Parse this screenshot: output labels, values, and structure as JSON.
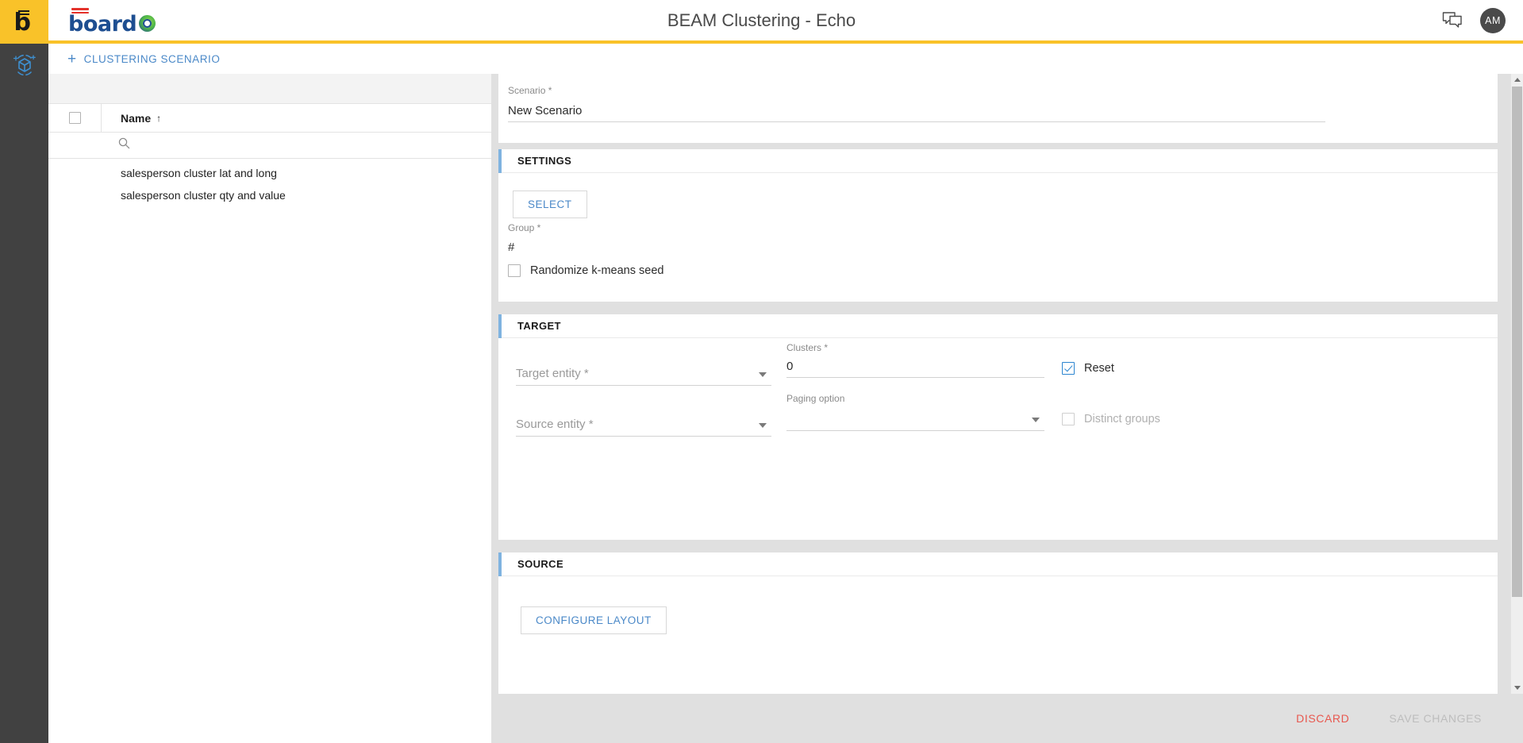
{
  "header": {
    "title": "BEAM Clustering - Echo",
    "logo_word": "board",
    "logo_mark_letter": "b",
    "chat_icon": "chat-bubbles-icon",
    "avatar_initials": "AM"
  },
  "rail": {
    "icon": "clustering-cube-icon"
  },
  "subheader": {
    "new_scenario_label": "CLUSTERING SCENARIO",
    "plus_glyph": "+"
  },
  "list_panel": {
    "columns": [
      "Name"
    ],
    "sort_glyph": "↑",
    "search_icon": "search-icon",
    "select_all_checkbox": "unchecked",
    "rows": [
      {
        "name": "salesperson cluster lat and long"
      },
      {
        "name": "salesperson cluster qty and value"
      }
    ]
  },
  "form": {
    "scenario": {
      "label": "Scenario *",
      "value": "New Scenario"
    },
    "settings": {
      "title": "SETTINGS",
      "select_button": "SELECT",
      "group_label": "Group *",
      "group_value": "#",
      "randomize_label": "Randomize k-means seed",
      "randomize_checked": false
    },
    "target": {
      "title": "TARGET",
      "target_entity_label": "Target entity *",
      "target_entity_value": "",
      "clusters_label": "Clusters *",
      "clusters_value": "0",
      "reset_label": "Reset",
      "reset_checked": true,
      "source_entity_label": "Source entity *",
      "source_entity_value": "",
      "paging_option_label": "Paging option",
      "paging_option_value": "",
      "distinct_groups_label": "Distinct groups",
      "distinct_groups_checked": false
    },
    "source": {
      "title": "SOURCE",
      "configure_layout_button": "CONFIGURE LAYOUT"
    }
  },
  "footer": {
    "discard_label": "DISCARD",
    "save_label": "SAVE CHANGES"
  },
  "colors": {
    "brand_yellow": "#f9c229",
    "brand_blue": "#1d4e91",
    "accent_blue": "#4b89c8",
    "section_accent": "#7fb3e0",
    "rail_dark": "#414141",
    "discard_red": "#e8584f",
    "checkbox_blue": "#2b85d0"
  }
}
